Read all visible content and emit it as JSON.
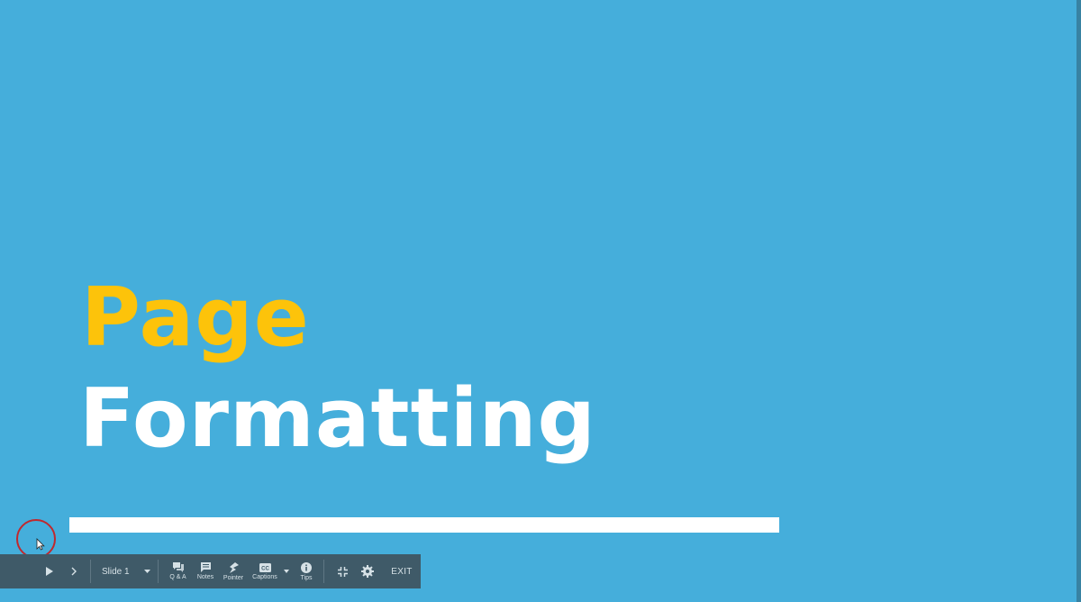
{
  "slide": {
    "title_line1": "Page",
    "title_line2": "Formatting",
    "colors": {
      "background": "#45aedb",
      "title_line1": "#fdc30a",
      "title_line2": "#ffffff",
      "underline": "#ffffff"
    }
  },
  "toolbar": {
    "play_icon": "play-icon",
    "next_icon": "chevron-right-icon",
    "slide_select_label": "Slide 1",
    "qa_label": "Q & A",
    "notes_label": "Notes",
    "pointer_label": "Pointer",
    "captions_label": "Captions",
    "tips_label": "Tips",
    "exit_label": "EXIT",
    "colors": {
      "background": "#3f5a68",
      "text": "#d6e1e6"
    }
  }
}
